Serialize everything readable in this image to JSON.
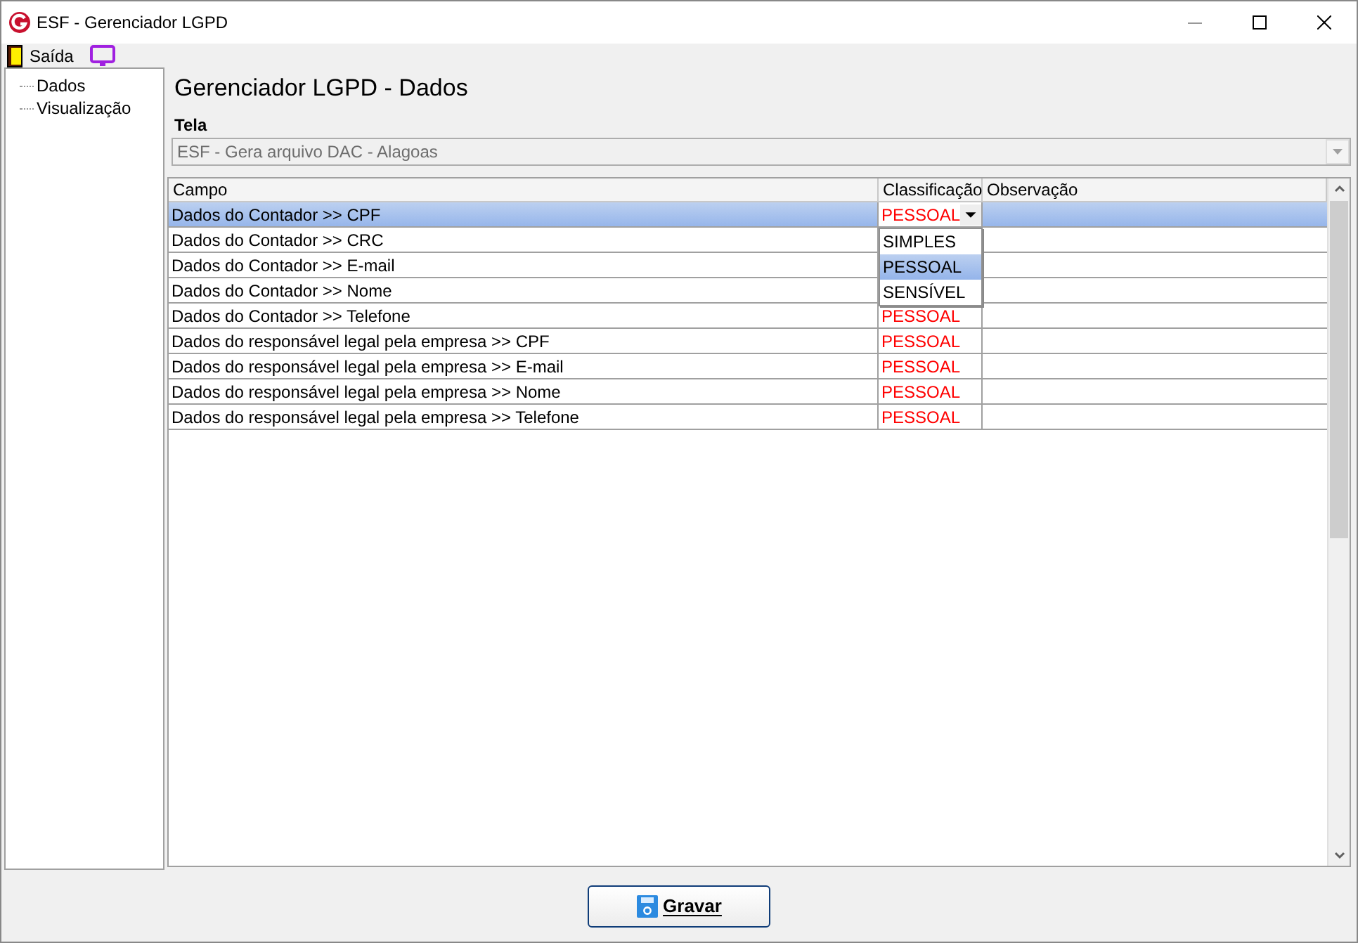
{
  "window": {
    "title": "ESF - Gerenciador LGPD"
  },
  "toolbar": [
    {
      "kind": "exit",
      "label": "Saída"
    },
    {
      "kind": "screen"
    }
  ],
  "tree": [
    {
      "label": "Dados"
    },
    {
      "label": "Visualização"
    }
  ],
  "heading": "Gerenciador LGPD - Dados",
  "tela": {
    "label": "Tela",
    "value": "ESF - Gera arquivo DAC - Alagoas",
    "disabled": true
  },
  "table": {
    "columns": [
      "Campo",
      "Classificação",
      "Observação"
    ],
    "rows": [
      {
        "campo": "Dados do Contador >> CPF",
        "classificacao": "PESSOAL",
        "selected": true,
        "editing": true
      },
      {
        "campo": "Dados do Contador >> CRC",
        "selected": false,
        "editing": false
      },
      {
        "campo": "Dados do Contador >> E-mail",
        "selected": false,
        "editing": false
      },
      {
        "campo": "Dados do Contador >> Nome",
        "selected": false,
        "editing": false
      },
      {
        "campo": "Dados do Contador >> Telefone",
        "classificacao": "PESSOAL",
        "selected": false,
        "editing": false
      },
      {
        "campo": "Dados do responsável legal pela empresa >> CPF",
        "classificacao": "PESSOAL",
        "selected": false,
        "editing": false
      },
      {
        "campo": "Dados do responsável legal pela empresa >> E-mail",
        "classificacao": "PESSOAL",
        "selected": false,
        "editing": false
      },
      {
        "campo": "Dados do responsável legal pela empresa >> Nome",
        "classificacao": "PESSOAL",
        "selected": false,
        "editing": false
      },
      {
        "campo": "Dados do responsável legal pela empresa >> Telefone",
        "classificacao": "PESSOAL",
        "selected": false,
        "editing": false
      }
    ],
    "dropdown": [
      {
        "label": "SIMPLES",
        "selected": false
      },
      {
        "label": "PESSOAL",
        "selected": true
      },
      {
        "label": "SENSÍVEL",
        "selected": false
      }
    ]
  },
  "save_button": {
    "label": "Gravar"
  }
}
